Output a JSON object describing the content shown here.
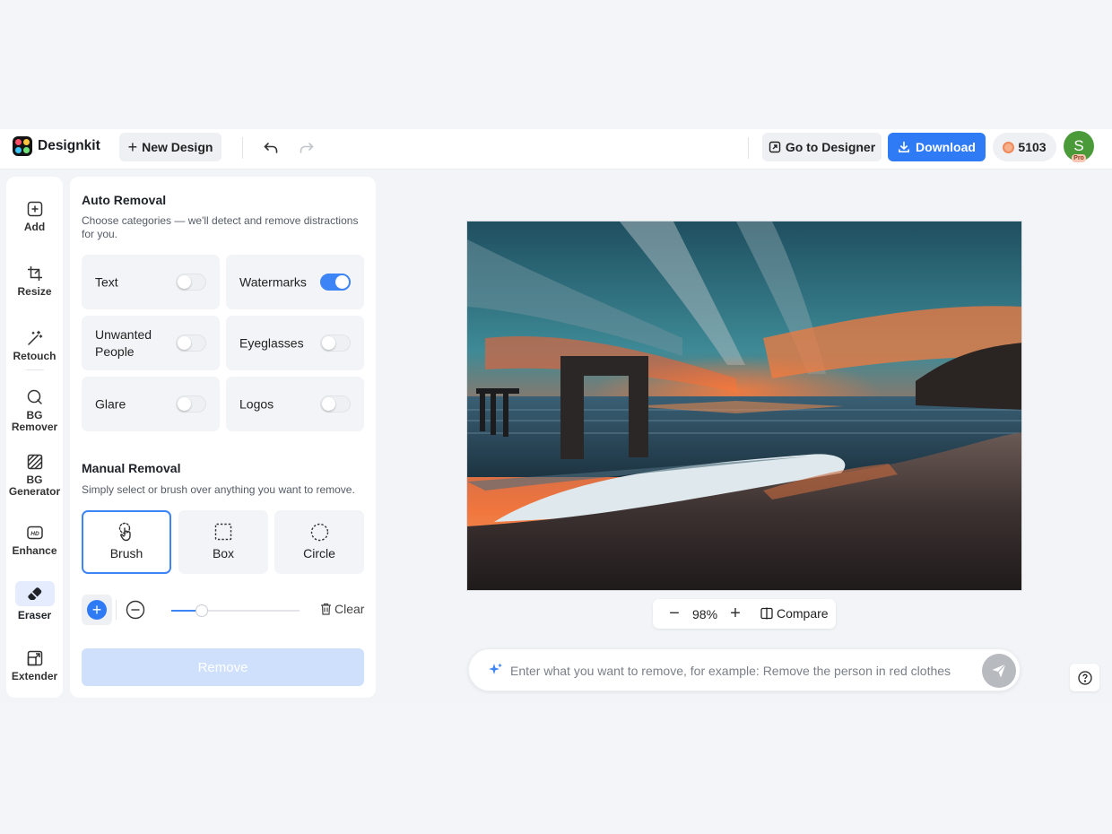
{
  "app": {
    "name": "Designkit"
  },
  "topbar": {
    "new_design_label": "New Design",
    "go_to_designer_label": "Go to Designer",
    "download_label": "Download",
    "credits": "5103",
    "avatar_initial": "S",
    "pro_badge": "Pro"
  },
  "tools": [
    {
      "label": "Add",
      "icon": "add-square-icon"
    },
    {
      "label": "Resize",
      "icon": "crop-icon"
    },
    {
      "label": "Retouch",
      "icon": "magic-wand-icon"
    },
    {
      "label": "BG Remover",
      "icon": "bg-remover-icon"
    },
    {
      "label": "BG Generator",
      "icon": "bg-generator-icon"
    },
    {
      "label": "Enhance",
      "icon": "hd-icon"
    },
    {
      "label": "Eraser",
      "icon": "eraser-icon",
      "active": true
    },
    {
      "label": "Extender",
      "icon": "extender-icon"
    }
  ],
  "auto_removal": {
    "title": "Auto Removal",
    "description": "Choose categories — we'll detect and remove distractions for you.",
    "options": [
      {
        "label": "Text",
        "on": false
      },
      {
        "label": "Watermarks",
        "on": true
      },
      {
        "label": "Unwanted People",
        "on": false
      },
      {
        "label": "Eyeglasses",
        "on": false
      },
      {
        "label": "Glare",
        "on": false
      },
      {
        "label": "Logos",
        "on": false
      }
    ]
  },
  "manual_removal": {
    "title": "Manual Removal",
    "description": "Simply select or brush over anything you want to remove.",
    "modes": [
      {
        "label": "Brush",
        "icon": "brush-hand-icon",
        "active": true
      },
      {
        "label": "Box",
        "icon": "box-select-icon",
        "active": false
      },
      {
        "label": "Circle",
        "icon": "circle-select-icon",
        "active": false
      }
    ],
    "brush_size_fraction": 0.24,
    "clear_label": "Clear",
    "remove_label": "Remove"
  },
  "canvas": {
    "zoom": "98%",
    "compare_label": "Compare",
    "prompt_placeholder": "Enter what you want to remove, for example: Remove the person in red clothes"
  },
  "colors": {
    "accent": "#2f7bf5",
    "toggle_on": "#3d84f6",
    "remove_disabled": "#cfe0fd"
  }
}
